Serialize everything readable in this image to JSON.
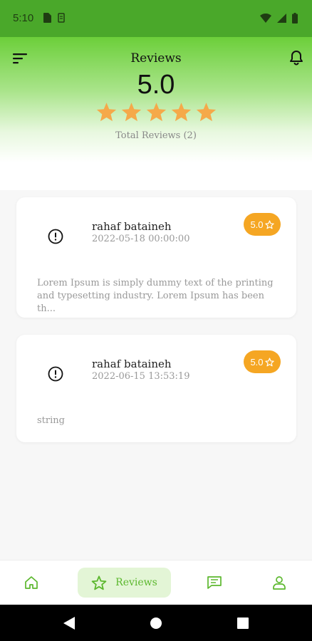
{
  "status_bar": {
    "time": "5:10"
  },
  "header": {
    "title": "Reviews",
    "rating": "5.0",
    "stars_filled": 5,
    "total_reviews": "Total Reviews (2)",
    "star_color": "#f5a94a"
  },
  "reviews": [
    {
      "name": "rahaf bataineh",
      "date": "2022-05-18 00:00:00",
      "rating": "5.0",
      "text": "Lorem Ipsum is simply dummy text of the printing and typesetting industry. Lorem Ipsum has been th..."
    },
    {
      "name": "rahaf bataineh",
      "date": "2022-06-15 13:53:19",
      "rating": "5.0",
      "text": "string"
    }
  ],
  "bottom_nav": {
    "items": [
      {
        "icon": "home-icon",
        "label": ""
      },
      {
        "icon": "star-icon",
        "label": "Reviews",
        "active": true
      },
      {
        "icon": "message-icon",
        "label": ""
      },
      {
        "icon": "profile-icon",
        "label": ""
      }
    ],
    "accent": "#5cb82e"
  },
  "colors": {
    "status_bar": "#4aa82a",
    "badge": "#f5a623"
  }
}
